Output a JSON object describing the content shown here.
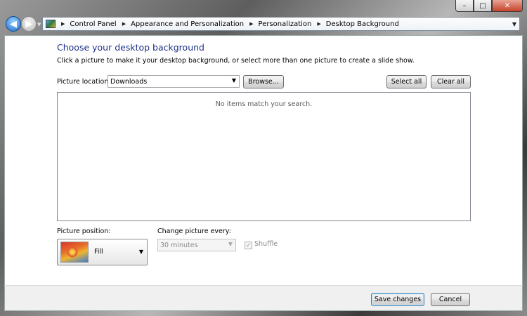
{
  "breadcrumb": [
    "Control Panel",
    "Appearance and Personalization",
    "Personalization",
    "Desktop Background"
  ],
  "page": {
    "title": "Choose your desktop background",
    "subtitle": "Click a picture to make it your desktop background, or select more than one picture to create a slide show."
  },
  "picture_location": {
    "label": "Picture location:",
    "value": "Downloads",
    "browse_label": "Browse...",
    "select_all_label": "Select all",
    "clear_all_label": "Clear all"
  },
  "pictures": {
    "empty_message": "No items match your search."
  },
  "picture_position": {
    "label": "Picture position:",
    "value": "Fill"
  },
  "change_picture": {
    "label": "Change picture every:",
    "value": "30 minutes",
    "shuffle_label": "Shuffle",
    "shuffle_checked": true
  },
  "footer": {
    "save_label": "Save changes",
    "cancel_label": "Cancel"
  },
  "window_controls": {
    "minimize": "–",
    "maximize": "□",
    "close": "✕"
  },
  "colors": {
    "title": "#1e3287",
    "accent": "#3c7fb1"
  }
}
